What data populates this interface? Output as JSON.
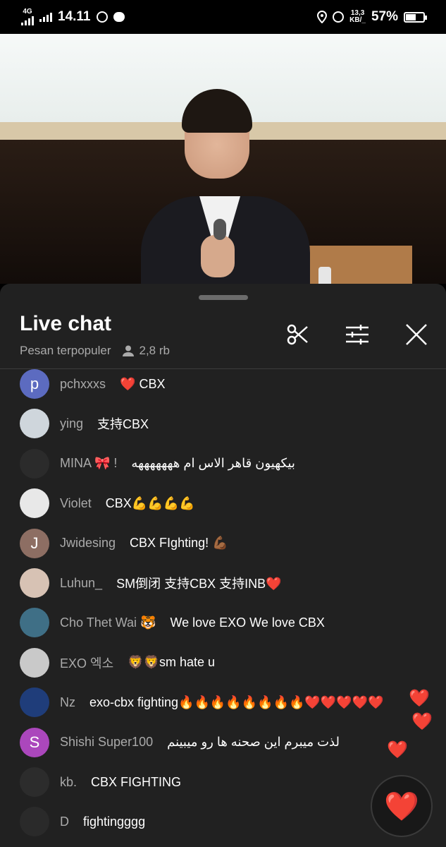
{
  "status_bar": {
    "network": "4G",
    "time": "14.11",
    "data_speed_value": "13,3",
    "data_speed_unit": "KB/_",
    "battery": "57%",
    "battery_level": 0.57
  },
  "chat": {
    "title": "Live chat",
    "mode": "Pesan terpopuler",
    "viewers": "2,8 rb",
    "messages": [
      {
        "author": "pchxxxs",
        "text": "❤️ CBX",
        "avatar_letter": "p",
        "avatar_color": "#5c6bc0"
      },
      {
        "author": "ying",
        "text": "支持CBX",
        "avatar_letter": "",
        "avatar_color": "#cfd6dc"
      },
      {
        "author": "MINA 🎀 !",
        "text": "بیکهیون قاهر الاس ام هههههههه",
        "avatar_letter": "",
        "avatar_color": "#2b2b2b"
      },
      {
        "author": "Violet",
        "text": "CBX💪💪💪💪",
        "avatar_letter": "",
        "avatar_color": "#e8e8e8"
      },
      {
        "author": "Jwidesing",
        "text": "CBX FIghting! 💪🏾",
        "avatar_letter": "J",
        "avatar_color": "#8d6e63"
      },
      {
        "author": "Luhun_",
        "text": "SM倒闭 支持CBX 支持INB❤️",
        "avatar_letter": "",
        "avatar_color": "#d7c2b4"
      },
      {
        "author": "Cho Thet Wai 🐯",
        "text": "We love EXO We love CBX",
        "avatar_letter": "",
        "avatar_color": "#3f6f86"
      },
      {
        "author": "EXO 엑소",
        "text": "🦁🦁sm hate u",
        "avatar_letter": "",
        "avatar_color": "#c9c9c9"
      },
      {
        "author": "Nz",
        "text": "exo-cbx fighting🔥🔥🔥🔥🔥🔥🔥🔥❤️❤️❤️❤️❤️",
        "avatar_letter": "",
        "avatar_color": "#1f3d7a"
      },
      {
        "author": "Shishi Super100",
        "text": "لذت میبرم این صحنه ها رو میبینم",
        "avatar_letter": "S",
        "avatar_color": "#ab47bc"
      },
      {
        "author": "kb.",
        "text": "CBX FIGHTING",
        "avatar_letter": "",
        "avatar_color": "#2c2c2c"
      },
      {
        "author": "D",
        "text": "fightingggg",
        "avatar_letter": "",
        "avatar_color": "#2a2a2a"
      }
    ]
  },
  "icons": {
    "clip": "scissors-icon",
    "filter": "sliders-icon",
    "close": "close-icon",
    "heart": "heart-icon",
    "viewers": "person-icon"
  },
  "reactions": {
    "button_emoji": "❤️",
    "floating": [
      "❤️",
      "❤️",
      "❤️"
    ]
  },
  "colors": {
    "panel_bg": "#212121",
    "author_text": "#aaaaaa",
    "message_text": "#ffffff"
  }
}
